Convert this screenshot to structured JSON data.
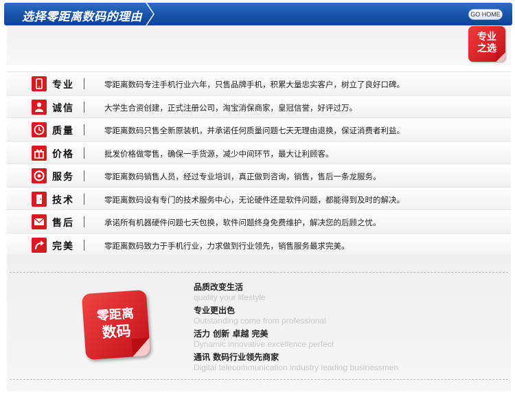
{
  "header": {
    "title": "选择零距离数码的理由",
    "home_button": "GO HOME"
  },
  "badge": {
    "line1": "专业",
    "line2": "之选"
  },
  "reasons": [
    {
      "label": "专业",
      "icon": "phone-icon",
      "desc": "零距离数码专注手机行业六年，只售品牌手机，积累大量忠实客户，树立了良好口碑。"
    },
    {
      "label": "诚信",
      "icon": "person-icon",
      "desc": "大学生合资创建，正式注册公司，淘宝消保商家，皇冠信誉，好评过万。"
    },
    {
      "label": "质量",
      "icon": "clock-icon",
      "desc": "零距离数码只售全新原装机，并承诺任何质量问题七天无理由退换，保证消费者利益。"
    },
    {
      "label": "价格",
      "icon": "gift-icon",
      "desc": "批发价格做零售，确保一手货源，减少中间环节，最大让利顾客。"
    },
    {
      "label": "服务",
      "icon": "lifebuoy-icon",
      "desc": "零距离数码销售人员，经过专业培训，真正做到咨询，销售，售后一条龙服务。"
    },
    {
      "label": "技术",
      "icon": "door-icon",
      "desc": "零距离数码设有专门的技术服务中心，无论硬件还是软件问题，都能得到及时的解决。"
    },
    {
      "label": "售后",
      "icon": "mail-icon",
      "desc": "承诺所有机器硬件问题七天包换，软件问题终身免费维护，解决您的后顾之忧。"
    },
    {
      "label": "完美",
      "icon": "arrow-icon",
      "desc": "零距离数码致力于手机行业，力求做到行业领先，销售服务最求完美。"
    }
  ],
  "logo": {
    "line1": "零距离",
    "line2": "数码"
  },
  "slogans": [
    {
      "cn": "品质改变生活",
      "en": "quality your lifestyle"
    },
    {
      "cn": "专业更出色",
      "en": "Outstanding come from professional"
    },
    {
      "cn": "活力 创新 卓越 完美",
      "en": "Dynamic innovative excellence perfect"
    },
    {
      "cn": "通讯 数码行业领先商家",
      "en": "Digital telecommunication industry leading businessmen"
    }
  ],
  "colors": {
    "brand_red": "#d71920",
    "header_blue": "#1752a6"
  }
}
